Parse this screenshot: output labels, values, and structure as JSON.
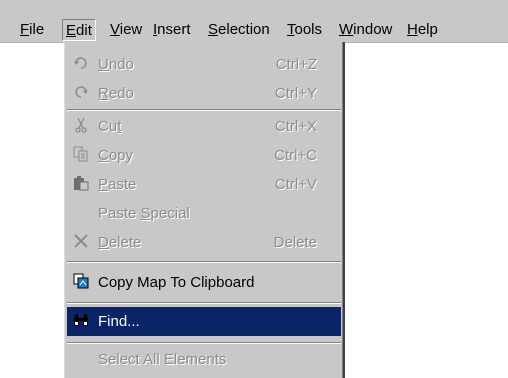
{
  "menubar": {
    "items": [
      {
        "label": "File",
        "mnemonic": "F"
      },
      {
        "label": "Edit",
        "mnemonic": "E"
      },
      {
        "label": "View",
        "mnemonic": "V"
      },
      {
        "label": "Insert",
        "mnemonic": "I"
      },
      {
        "label": "Selection",
        "mnemonic": "S"
      },
      {
        "label": "Tools",
        "mnemonic": "T"
      },
      {
        "label": "Window",
        "mnemonic": "W"
      },
      {
        "label": "Help",
        "mnemonic": "H"
      }
    ],
    "active": "Edit"
  },
  "edit_menu": {
    "items": [
      {
        "label": "Undo",
        "shortcut": "Ctrl+Z",
        "icon": "undo-icon",
        "enabled": false
      },
      {
        "label": "Redo",
        "shortcut": "Ctrl+Y",
        "icon": "redo-icon",
        "enabled": false
      },
      {
        "label": "Cut",
        "shortcut": "Ctrl+X",
        "icon": "scissors-icon",
        "enabled": false
      },
      {
        "label": "Copy",
        "shortcut": "Ctrl+C",
        "icon": "copy-icon",
        "enabled": false
      },
      {
        "label": "Paste",
        "shortcut": "Ctrl+V",
        "icon": "paste-icon",
        "enabled": false
      },
      {
        "label": "Paste Special",
        "shortcut": "",
        "icon": "",
        "enabled": false
      },
      {
        "label": "Delete",
        "shortcut": "Delete",
        "icon": "delete-x-icon",
        "enabled": false
      },
      {
        "label": "Copy Map To Clipboard",
        "shortcut": "",
        "icon": "copy-map-icon",
        "enabled": true
      },
      {
        "label": "Find...",
        "shortcut": "",
        "icon": "binoculars-icon",
        "enabled": true,
        "selected": true
      },
      {
        "label": "Select All Elements",
        "shortcut": "",
        "icon": "",
        "enabled": false
      }
    ]
  },
  "colors": {
    "menu_background": "#c8c8c8",
    "selection_highlight": "#0a246a",
    "disabled_text": "#8c8c8c"
  }
}
